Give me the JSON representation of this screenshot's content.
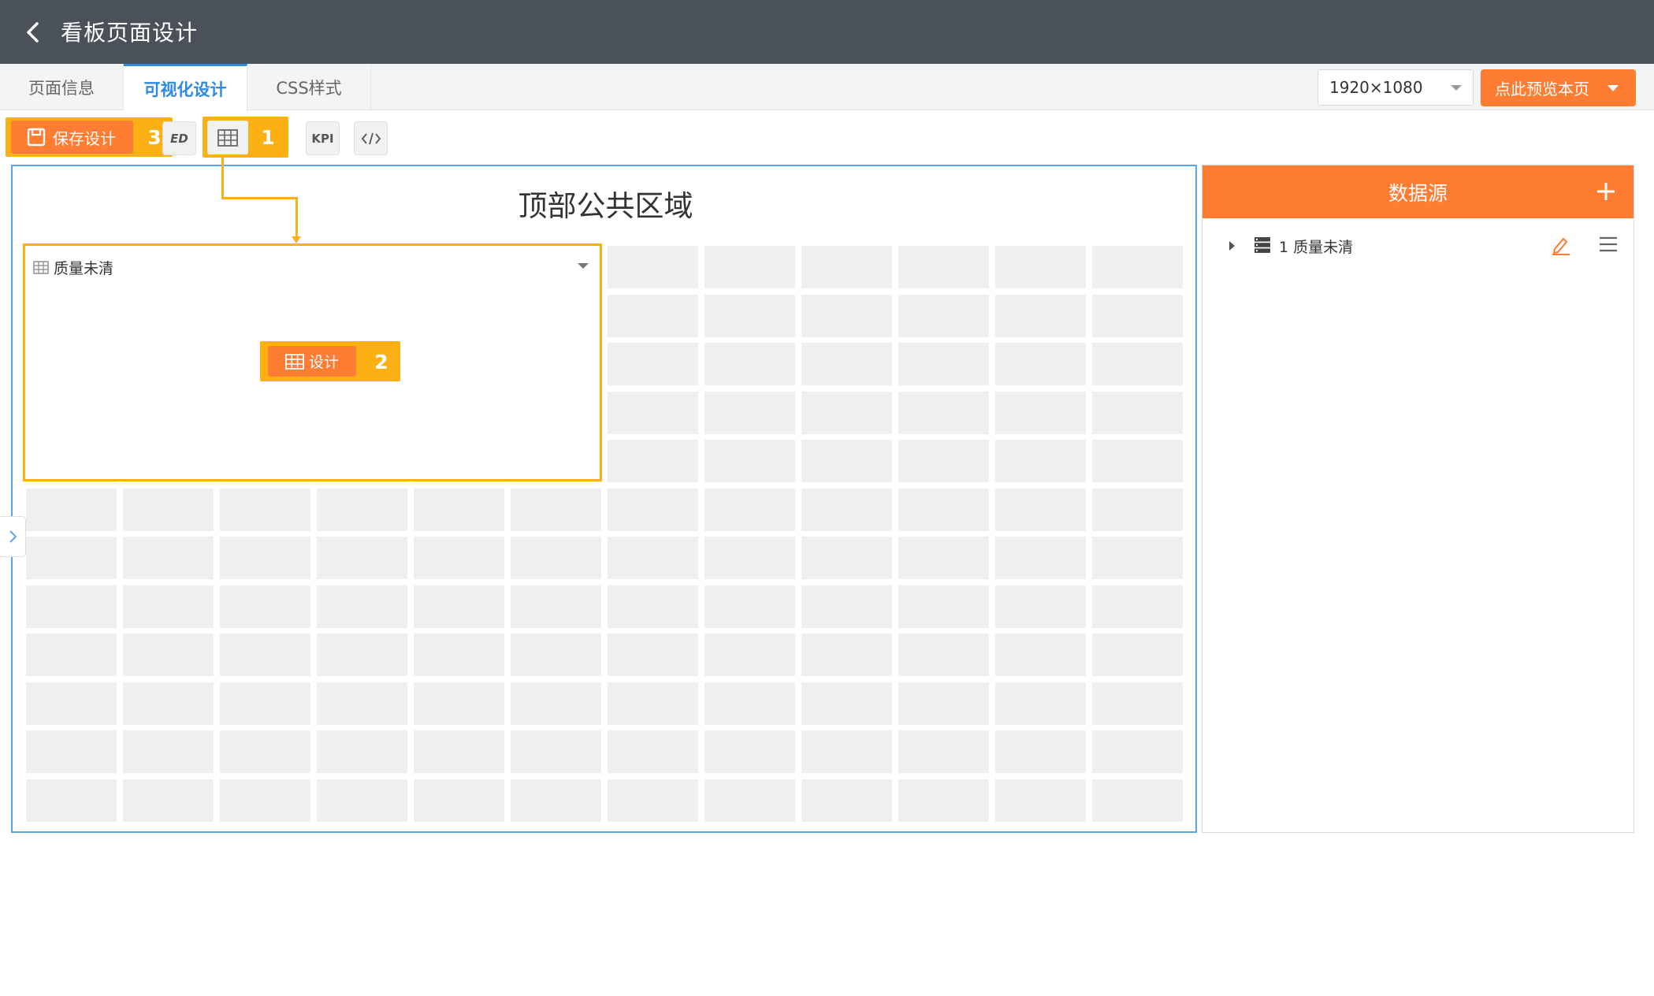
{
  "header": {
    "title": "看板页面设计"
  },
  "tabs": [
    {
      "label": "页面信息",
      "active": false
    },
    {
      "label": "可视化设计",
      "active": true
    },
    {
      "label": "CSS样式",
      "active": false
    }
  ],
  "resolution": {
    "value": "1920×1080"
  },
  "preview_button": {
    "label": "点此预览本页"
  },
  "toolbar": {
    "save_label": "保存设计",
    "partial_button_label": "ED",
    "kpi_label": "KPI",
    "code_label": "</>"
  },
  "callouts": {
    "one": "1",
    "two": "2",
    "three": "3"
  },
  "canvas": {
    "title": "顶部公共区域",
    "widget": {
      "title": "质量未清",
      "design_label": "设计"
    }
  },
  "datasource": {
    "title": "数据源",
    "items": [
      {
        "index": "1",
        "name": "质量未清"
      }
    ]
  },
  "colors": {
    "header_bg": "#4b5159",
    "accent_orange": "#ff7c33",
    "highlight_yellow": "#fcb013",
    "active_tab_blue": "#2d8ae0",
    "canvas_border": "#5aa3ec",
    "grid_cell": "#efefef"
  },
  "icons": [
    "back-arrow-icon",
    "save-icon",
    "table-icon",
    "code-icon",
    "chevron-right-icon",
    "plus-icon",
    "database-icon",
    "edit-pencil-icon",
    "menu-icon",
    "dropdown-caret-icon",
    "expand-triangle-icon"
  ]
}
